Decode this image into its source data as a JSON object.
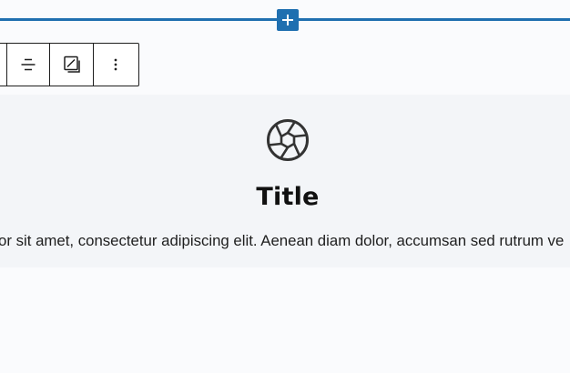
{
  "editor": {
    "inserter_symbol": "+",
    "accent_color": "#1f6fb0"
  },
  "toolbar": {
    "buttons": [
      {
        "name": "align",
        "icon": "justify-center-icon"
      },
      {
        "name": "layout",
        "icon": "edit-image-icon"
      },
      {
        "name": "more-options",
        "icon": "vertical-ellipsis-icon"
      }
    ]
  },
  "feature": {
    "icon": "camera-aperture-icon",
    "title": "Title",
    "description": "olor sit amet, consectetur adipiscing elit. Aenean diam dolor, accumsan sed rutrum ve"
  }
}
